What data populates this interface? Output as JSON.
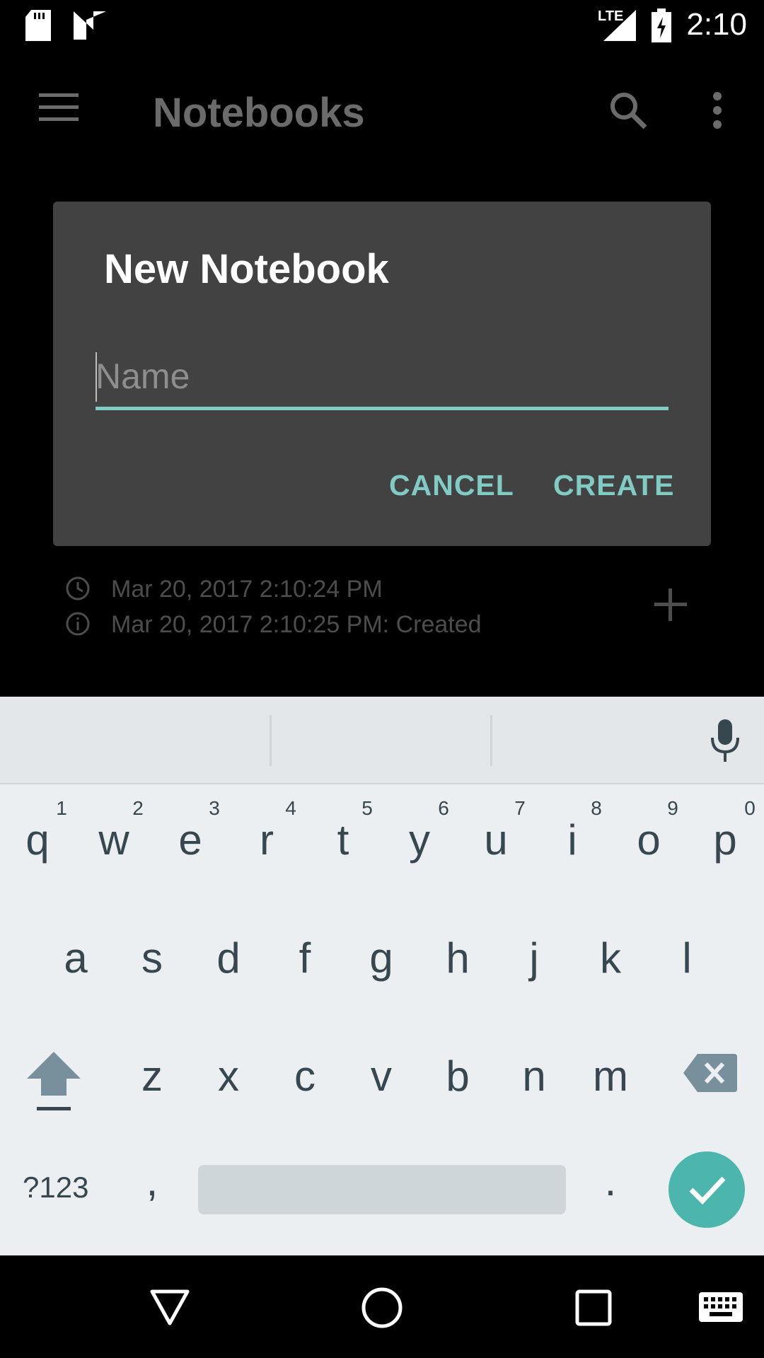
{
  "status_bar": {
    "time": "2:10",
    "network": "LTE",
    "icons": [
      "sd-card-icon",
      "n-logo-icon",
      "signal-icon",
      "battery-charging-icon"
    ]
  },
  "app_bar": {
    "title": "Notebooks",
    "icons": [
      "menu-icon",
      "search-icon",
      "overflow-menu-icon"
    ]
  },
  "background_item": {
    "updated": "Mar 20, 2017 2:10:24 PM",
    "created": "Mar 20, 2017 2:10:25 PM: Created",
    "icons": [
      "clock-icon",
      "info-icon",
      "add-icon"
    ]
  },
  "dialog": {
    "title": "New Notebook",
    "name_value": "",
    "name_placeholder": "Name",
    "cancel_label": "CANCEL",
    "create_label": "CREATE"
  },
  "keyboard": {
    "row1": [
      "q",
      "w",
      "e",
      "r",
      "t",
      "y",
      "u",
      "i",
      "o",
      "p"
    ],
    "row1_hints": [
      "1",
      "2",
      "3",
      "4",
      "5",
      "6",
      "7",
      "8",
      "9",
      "0"
    ],
    "row2": [
      "a",
      "s",
      "d",
      "f",
      "g",
      "h",
      "j",
      "k",
      "l"
    ],
    "row3": [
      "z",
      "x",
      "c",
      "v",
      "b",
      "n",
      "m"
    ],
    "symbols_label": "?123",
    "comma": ",",
    "period": ".",
    "icons": [
      "mic-icon",
      "shift-icon",
      "backspace-icon",
      "enter-check-icon"
    ]
  },
  "nav_bar": {
    "icons": [
      "back-icon",
      "home-icon",
      "recents-icon",
      "keyboard-switch-icon"
    ]
  },
  "colors": {
    "accent": "#80cbc4",
    "dialog_bg": "#424242",
    "keyboard_bg": "#eceff1",
    "enter_key": "#4db6ac"
  }
}
